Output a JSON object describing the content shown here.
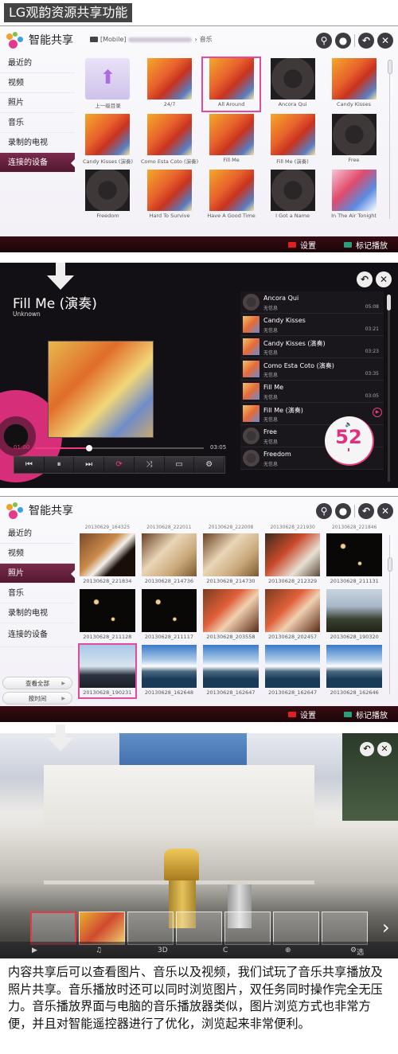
{
  "page_title": "LG观韵资源共享功能",
  "share_app": {
    "name": "智能共享",
    "breadcrumb": {
      "root": "[Mobile]",
      "separator": "›",
      "current": "音乐"
    },
    "header_icons": [
      "search-icon",
      "user-icon",
      "back-icon",
      "close-icon"
    ],
    "header_glyphs": {
      "search": "⚲",
      "user": "●",
      "back": "↶",
      "close": "✕"
    }
  },
  "sidebar": {
    "items": [
      {
        "label": "最近的"
      },
      {
        "label": "视频"
      },
      {
        "label": "照片"
      },
      {
        "label": "音乐"
      },
      {
        "label": "录制的电视"
      },
      {
        "label": "连接的设备"
      }
    ]
  },
  "music_browser": {
    "active_sidebar": "连接的设备",
    "items": [
      {
        "label": "上一级目录",
        "type": "folder-up"
      },
      {
        "label": "24/7",
        "type": "cover"
      },
      {
        "label": "All Around",
        "type": "cover",
        "selected": true
      },
      {
        "label": "Ancora Qui",
        "type": "disc"
      },
      {
        "label": "Candy Kisses",
        "type": "cover"
      },
      {
        "label": "Candy Kisses (演奏)",
        "type": "cover"
      },
      {
        "label": "Como Esta Coto (演奏)",
        "type": "cover"
      },
      {
        "label": "Fill Me",
        "type": "cover"
      },
      {
        "label": "Fill Me (演奏)",
        "type": "cover"
      },
      {
        "label": "Free",
        "type": "disc"
      },
      {
        "label": "Freedom",
        "type": "disc"
      },
      {
        "label": "Hard To Survive",
        "type": "cover"
      },
      {
        "label": "Have A Good Time",
        "type": "cover"
      },
      {
        "label": "I Got a Name",
        "type": "disc"
      },
      {
        "label": "In The Air Tonight",
        "type": "air"
      }
    ]
  },
  "footer": {
    "settings_label": "设置",
    "settings_color": "#e02020",
    "mark_play_label": "标记播放",
    "mark_play_color": "#2aa07a"
  },
  "player": {
    "title": "Fill Me (演奏)",
    "artist": "Unknown",
    "current_time": "01:00",
    "total_time": "03:05",
    "progress_fraction": 0.32,
    "volume": "52",
    "controls": [
      "⏮",
      "⏸",
      "⏭",
      "⟳",
      "⤨",
      "▭",
      "⚙"
    ],
    "playlist": [
      {
        "name": "Ancora Qui",
        "info": "无信息",
        "duration": "05:08",
        "thumb": "disc"
      },
      {
        "name": "Candy Kisses",
        "info": "无信息",
        "duration": "03:21",
        "thumb": "cover"
      },
      {
        "name": "Candy Kisses (演奏)",
        "info": "无信息",
        "duration": "03:23",
        "thumb": "cover"
      },
      {
        "name": "Como Esta Coto (演奏)",
        "info": "无信息",
        "duration": "03:35",
        "thumb": "cover"
      },
      {
        "name": "Fill Me",
        "info": "无信息",
        "duration": "03:05",
        "thumb": "cover"
      },
      {
        "name": "Fill Me (演奏)",
        "info": "无信息",
        "duration": "",
        "thumb": "cover",
        "playing": true
      },
      {
        "name": "Free",
        "info": "无信息",
        "duration": "",
        "thumb": "disc"
      },
      {
        "name": "Freedom",
        "info": "无信息",
        "duration": "",
        "thumb": "disc"
      }
    ]
  },
  "photo_browser": {
    "active_sidebar": "照片",
    "prev_row_labels": [
      "20130629_164325",
      "20130628_222011",
      "20130628_222008",
      "20130628_221930",
      "20130628_221846"
    ],
    "photos": [
      {
        "label": "20130628_221834",
        "tone": "coffee"
      },
      {
        "label": "20130628_214736",
        "tone": "food-light"
      },
      {
        "label": "20130628_214730",
        "tone": "food-light"
      },
      {
        "label": "20130628_212329",
        "tone": "food-dark"
      },
      {
        "label": "20130628_211131",
        "tone": "night"
      },
      {
        "label": "20130628_211128",
        "tone": "night"
      },
      {
        "label": "20130628_211117",
        "tone": "night"
      },
      {
        "label": "20130628_203558",
        "tone": "crab"
      },
      {
        "label": "20130628_202457",
        "tone": "crab"
      },
      {
        "label": "20130628_190320",
        "tone": "city"
      },
      {
        "label": "20130628_190231",
        "tone": "harbor-dusk",
        "selected": true
      },
      {
        "label": "20130628_162648",
        "tone": "harbor"
      },
      {
        "label": "20130628_162647",
        "tone": "harbor"
      },
      {
        "label": "20130628_162647",
        "tone": "harbor"
      },
      {
        "label": "20130628_162646",
        "tone": "harbor"
      }
    ],
    "view_all_label": "查看全部",
    "by_time_label": "按时间"
  },
  "photo_viewer": {
    "options_label": "选项",
    "bar_icons": [
      "▶",
      "♫",
      "3D",
      "C",
      "⊕"
    ],
    "filmstrip_count": 7
  },
  "caption": "内容共享后可以查看图片、音乐以及视频，我们试玩了音乐共享播放及照片共享。音乐播放时还可以同时浏览图片，双任务同时操作完全无压力。音乐播放界面与电脑的音乐播放器类似，图片浏览方式也非常方便，并且对智能遥控器进行了优化，浏览起来非常便利。"
}
